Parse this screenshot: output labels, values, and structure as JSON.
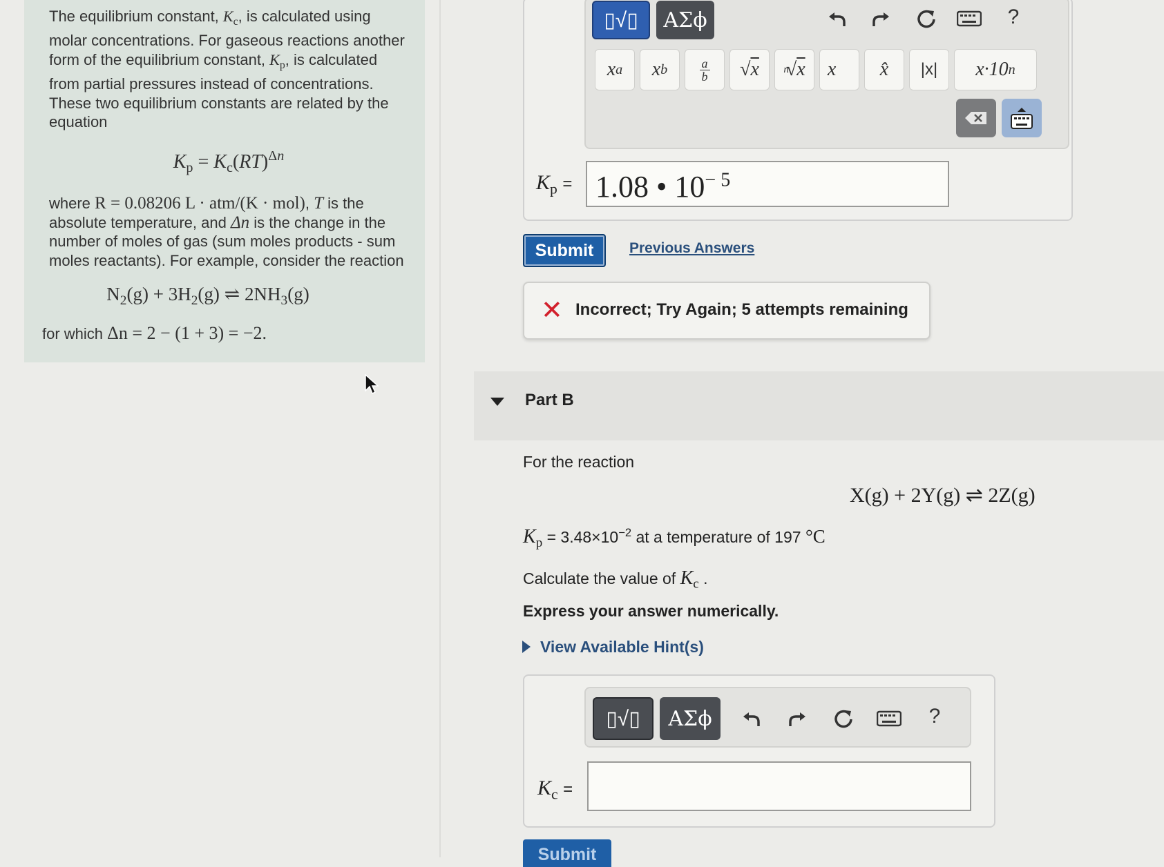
{
  "intro": {
    "para1_a": "The equilibrium constant, ",
    "para1_kc": "K",
    "para1_kc_sub": "c",
    "para1_b": ", is calculated using molar concentrations. For gaseous reactions another form of the equilibrium constant, ",
    "para1_kp": "K",
    "para1_kp_sub": "p",
    "para1_c": ", is calculated from partial pressures instead of concentrations. These two equilibrium constants are related by the equation",
    "equation": "Kp = Kc(RT)^Δn",
    "para2_a": "where ",
    "para2_r": "R = 0.08206 L · atm/(K · mol)",
    "para2_b": ", ",
    "para2_t": "T",
    "para2_c": " is the absolute temperature, and ",
    "para2_dn": "Δn",
    "para2_d": " is the change in the number of moles of gas (sum moles products - sum moles reactants). For example, consider the reaction",
    "reaction": "N2(g) + 3H2(g) ⇌ 2NH3(g)",
    "para3_a": "for which ",
    "para3_eq": "Δn = 2 − (1 + 3) = −2."
  },
  "partA": {
    "toolbar": {
      "templates_label": "▯√▯",
      "greek_label": "ΑΣϕ",
      "undo": "undo-icon",
      "redo": "redo-icon",
      "reset": "reset-icon",
      "keyboard": "keyboard-icon",
      "help": "?",
      "templates": [
        "xᵃ",
        "x_b",
        "a/b",
        "√x",
        "ⁿ√x",
        "x⃗",
        "x̂",
        "|x|",
        "x·10ⁿ"
      ]
    },
    "answer_label": "Kp =",
    "answer_value": "1.08 • 10",
    "answer_exponent": "− 5",
    "submit_label": "Submit",
    "previous_answers_label": "Previous Answers",
    "feedback_text": "Incorrect; Try Again; 5 attempts remaining"
  },
  "partB": {
    "title": "Part B",
    "intro": "For the reaction",
    "reaction": "X(g) + 2Y(g) ⇌ 2Z(g)",
    "kp_line_value": " = 3.48×10",
    "kp_line_exp": "−2",
    "kp_line_rest": " at a temperature of 197 ",
    "kp_line_unit": "°C",
    "calc_a": "Calculate the value of ",
    "calc_b": " .",
    "instruction": "Express your answer numerically.",
    "hint_label": "View Available Hint(s)",
    "toolbar": {
      "templates_label": "▯√▯",
      "greek_label": "ΑΣϕ",
      "help": "?"
    },
    "answer_label": "Kc =",
    "answer_value": "",
    "submit_label": "Submit"
  }
}
